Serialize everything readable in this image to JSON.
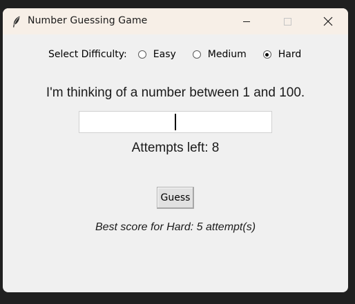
{
  "window": {
    "title": "Number Guessing Game",
    "icon": "feather-icon",
    "controls": [
      "minimize-icon",
      "maximize-icon",
      "close-icon"
    ]
  },
  "difficulty": {
    "label": "Select Difficulty:",
    "options": [
      {
        "label": "Easy",
        "selected": false
      },
      {
        "label": "Medium",
        "selected": false
      },
      {
        "label": "Hard",
        "selected": true
      }
    ]
  },
  "game": {
    "prompt": "I'm thinking of a number between 1 and 100.",
    "guess_value": "",
    "attempts_text": "Attempts left: 8",
    "guess_button_label": "Guess",
    "best_score_text": "Best score for Hard: 5 attempt(s)"
  }
}
